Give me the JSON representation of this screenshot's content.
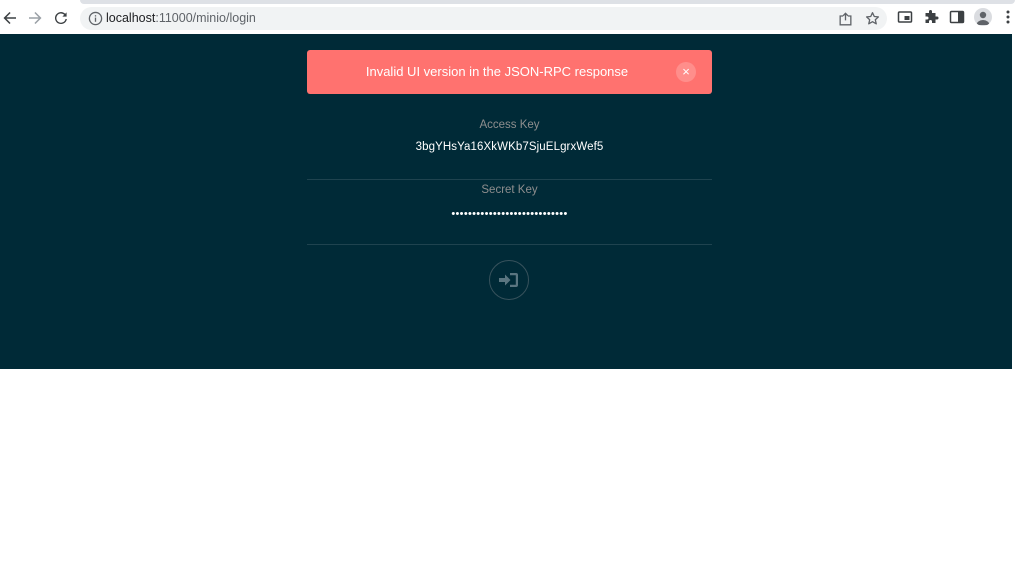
{
  "browser": {
    "url_host": "localhost",
    "url_rest": ":11000/minio/login",
    "icons": [
      "back-icon",
      "forward-icon",
      "reload-icon",
      "info-icon",
      "share-icon",
      "star-icon",
      "picture-in-picture-icon",
      "extensions-icon",
      "side-panel-icon",
      "profile-icon",
      "menu-icon"
    ]
  },
  "alert": {
    "message": "Invalid UI version in the JSON-RPC response",
    "close_symbol": "×",
    "color": "#ff726f"
  },
  "login": {
    "access_key_label": "Access Key",
    "access_key_value": "3bgYHsYa16XkWKb7SjuELgrxWef5",
    "secret_key_label": "Secret Key",
    "secret_key_value": "••••••••••••••••••••••••••••",
    "submit_icon": "sign-in-icon"
  },
  "colors": {
    "page_background": "#002a37",
    "label": "#8e8e8e"
  }
}
